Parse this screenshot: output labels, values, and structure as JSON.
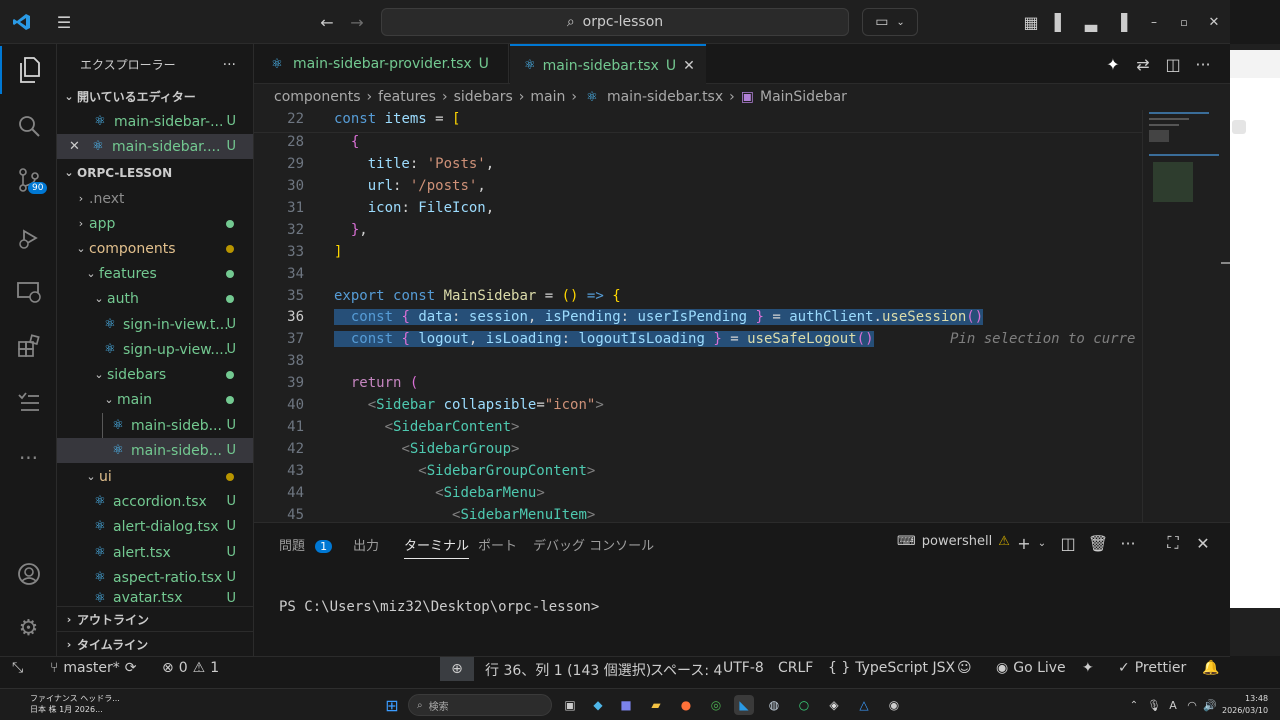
{
  "titlebar": {
    "search_text": "orpc-lesson"
  },
  "activity": {
    "source_control_badge": "90"
  },
  "sidebar": {
    "title": "エクスプローラー",
    "open_editors_header": "開いているエディター",
    "open_editors": [
      {
        "label": "main-sidebar-...",
        "status": "U"
      },
      {
        "label": "main-sidebar....",
        "status": "U"
      }
    ],
    "project_header": "ORPC-LESSON",
    "tree": [
      {
        "label": ".next",
        "status": ""
      },
      {
        "label": "app",
        "status": ""
      },
      {
        "label": "components",
        "status": ""
      },
      {
        "label": "features",
        "status": ""
      },
      {
        "label": "auth",
        "status": ""
      },
      {
        "label": "sign-in-view.t...",
        "status": "U"
      },
      {
        "label": "sign-up-view....",
        "status": "U"
      },
      {
        "label": "sidebars",
        "status": ""
      },
      {
        "label": "main",
        "status": ""
      },
      {
        "label": "main-sideb...",
        "status": "U"
      },
      {
        "label": "main-sideb...",
        "status": "U"
      },
      {
        "label": "ui",
        "status": ""
      },
      {
        "label": "accordion.tsx",
        "status": "U"
      },
      {
        "label": "alert-dialog.tsx",
        "status": "U"
      },
      {
        "label": "alert.tsx",
        "status": "U"
      },
      {
        "label": "aspect-ratio.tsx",
        "status": "U"
      },
      {
        "label": "avatar.tsx",
        "status": "U"
      }
    ],
    "outline_header": "アウトライン",
    "timeline_header": "タイムライン"
  },
  "tabs": [
    {
      "label": "main-sidebar-provider.tsx",
      "status": "U"
    },
    {
      "label": "main-sidebar.tsx",
      "status": "U"
    }
  ],
  "breadcrumb": [
    "components",
    "features",
    "sidebars",
    "main",
    "main-sidebar.tsx",
    "MainSidebar"
  ],
  "editor": {
    "line_numbers": [
      "22",
      "28",
      "29",
      "30",
      "31",
      "32",
      "33",
      "34",
      "35",
      "36",
      "37",
      "38",
      "39",
      "40",
      "41",
      "42",
      "43",
      "44",
      "45"
    ],
    "inline_hint": "Pin selection to curre"
  },
  "panel": {
    "tabs": [
      "問題",
      "出力",
      "ターミナル",
      "ポート",
      "デバッグ コンソール"
    ],
    "problems_count": "1",
    "shell_label": "powershell",
    "terminal_line": "PS C:\\Users\\miz32\\Desktop\\orpc-lesson>"
  },
  "statusbar": {
    "branch": "master*",
    "errors": "0",
    "warnings": "1",
    "position": "行 36、列 1 (143 個選択)",
    "spaces": "スペース: 4",
    "encoding": "UTF-8",
    "eol": "CRLF",
    "language": "TypeScript JSX",
    "go_live": "Go Live",
    "prettier": "Prettier"
  },
  "taskbar": {
    "news_title": "ファイナンス ヘッドラ...",
    "news_sub": "日本 株 1月 2026...",
    "search_placeholder": "検索",
    "time": "13:48",
    "date": "2026/03/10",
    "ime": "A"
  },
  "colors": {
    "accent": "#0078d4",
    "untracked": "#73c991",
    "modified_dot": "#b89500"
  }
}
